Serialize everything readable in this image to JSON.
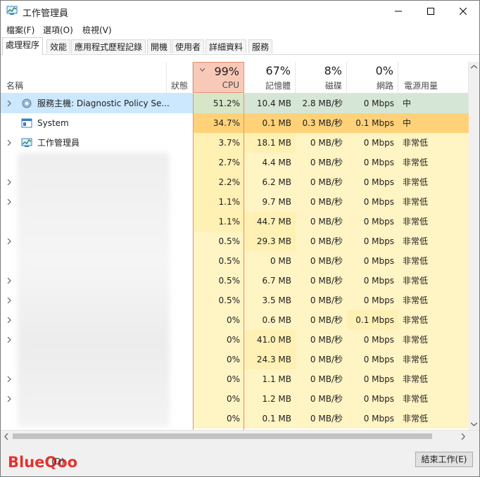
{
  "window": {
    "title": "工作管理員"
  },
  "menu": [
    "檔案(F)",
    "選項(O)",
    "檢視(V)"
  ],
  "tabs": [
    "處理程序",
    "效能",
    "應用程式歷程記錄",
    "開機",
    "使用者",
    "詳細資料",
    "服務"
  ],
  "columns": {
    "name": "名稱",
    "status": "狀態",
    "cpu": {
      "pct": "99%",
      "label": "CPU"
    },
    "memory": {
      "pct": "67%",
      "label": "記憶體"
    },
    "disk": {
      "pct": "8%",
      "label": "磁碟"
    },
    "network": {
      "pct": "0%",
      "label": "網路"
    },
    "power": {
      "label": "電源用量"
    }
  },
  "rows": [
    {
      "name": "服務主機: Diagnostic Policy Se...",
      "cpu": "51.2%",
      "mem": "10.4 MB",
      "disk": "2.8 MB/秒",
      "net": "0 Mbps",
      "power": "中"
    },
    {
      "name": "System",
      "cpu": "34.7%",
      "mem": "0.1 MB",
      "disk": "0.3 MB/秒",
      "net": "0.1 Mbps",
      "power": "中"
    },
    {
      "name": "工作管理員",
      "cpu": "3.7%",
      "mem": "18.1 MB",
      "disk": "0 MB/秒",
      "net": "0 Mbps",
      "power": "非常低"
    },
    {
      "name": "",
      "cpu": "2.7%",
      "mem": "4.4 MB",
      "disk": "0 MB/秒",
      "net": "0 Mbps",
      "power": "非常低"
    },
    {
      "name": "",
      "cpu": "2.2%",
      "mem": "6.2 MB",
      "disk": "0 MB/秒",
      "net": "0 Mbps",
      "power": "非常低"
    },
    {
      "name": "",
      "cpu": "1.1%",
      "mem": "9.7 MB",
      "disk": "0 MB/秒",
      "net": "0 Mbps",
      "power": "非常低"
    },
    {
      "name": "",
      "cpu": "1.1%",
      "mem": "44.7 MB",
      "disk": "0 MB/秒",
      "net": "0 Mbps",
      "power": "非常低"
    },
    {
      "name": "",
      "cpu": "0.5%",
      "mem": "29.3 MB",
      "disk": "0 MB/秒",
      "net": "0 Mbps",
      "power": "非常低"
    },
    {
      "name": "",
      "cpu": "0.5%",
      "mem": "0 MB",
      "disk": "0 MB/秒",
      "net": "0 Mbps",
      "power": "非常低"
    },
    {
      "name": "",
      "cpu": "0.5%",
      "mem": "6.7 MB",
      "disk": "0 MB/秒",
      "net": "0 Mbps",
      "power": "非常低"
    },
    {
      "name": "",
      "cpu": "0.5%",
      "mem": "3.5 MB",
      "disk": "0 MB/秒",
      "net": "0 Mbps",
      "power": "非常低"
    },
    {
      "name": "",
      "cpu": "0%",
      "mem": "0.6 MB",
      "disk": "0 MB/秒",
      "net": "0.1 Mbps",
      "power": "非常低"
    },
    {
      "name": "",
      "cpu": "0%",
      "mem": "41.0 MB",
      "disk": "0 MB/秒",
      "net": "0 Mbps",
      "power": "非常低"
    },
    {
      "name": "",
      "cpu": "0%",
      "mem": "24.3 MB",
      "disk": "0 MB/秒",
      "net": "0 Mbps",
      "power": "非常低"
    },
    {
      "name": "",
      "cpu": "0%",
      "mem": "1.1 MB",
      "disk": "0 MB/秒",
      "net": "0 Mbps",
      "power": "非常低"
    },
    {
      "name": "",
      "cpu": "0%",
      "mem": "1.2 MB",
      "disk": "0 MB/秒",
      "net": "0 Mbps",
      "power": "非常低"
    },
    {
      "name": "",
      "cpu": "0%",
      "mem": "0.1 MB",
      "disk": "0 MB/秒",
      "net": "0 Mbps",
      "power": "非常低"
    }
  ],
  "footer": {
    "brand": "BlueQoo",
    "details_tail": "(D)",
    "end_task": "結束工作(E)"
  },
  "colors": {
    "selected": "#cce8ff",
    "heat_high": "#ffd27a",
    "heat_mid": "#fff0b3",
    "heat_low": "#fff4c4",
    "cpu_header": "#f9c9b7",
    "brand": "#e4322f"
  }
}
